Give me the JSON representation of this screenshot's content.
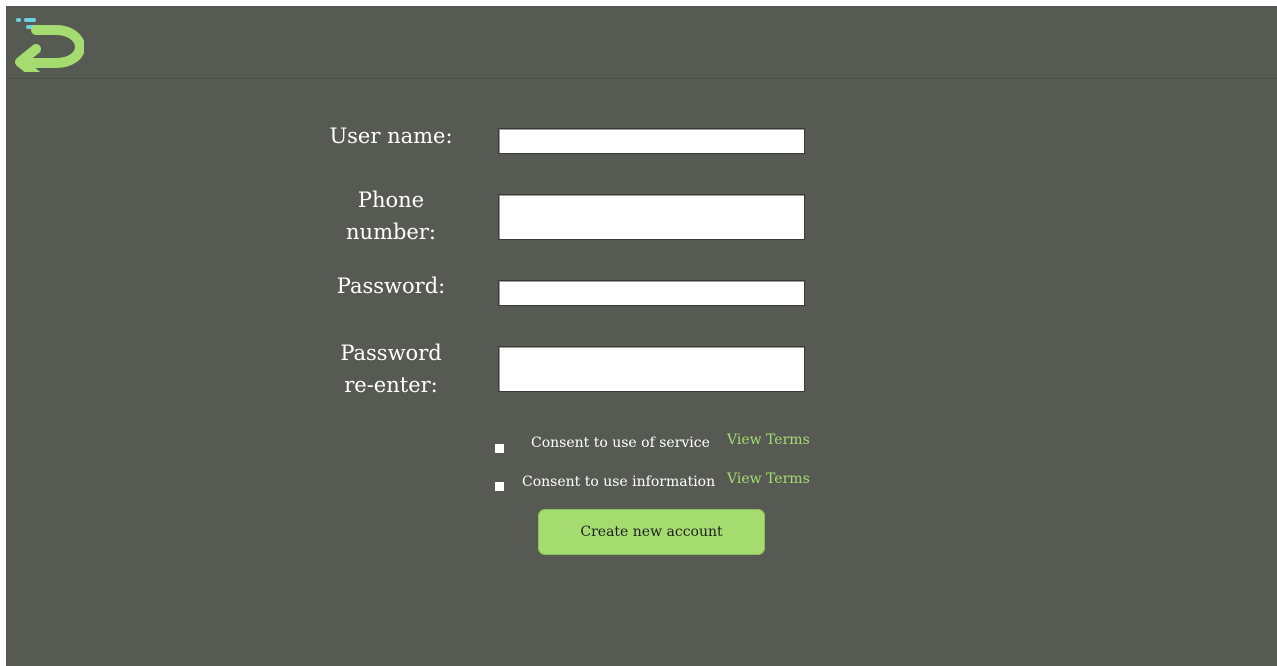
{
  "header": {
    "back_icon": "return-arrow-icon",
    "accent_color": "#a5dc70",
    "dash_color": "#6fd0e3"
  },
  "form": {
    "username_label": "User name:",
    "phone_label": "Phone\nnumber:",
    "password_label": "Password:",
    "password_reenter_label": "Password\nre-enter:",
    "username_value": "",
    "phone_value": "",
    "password_value": "",
    "password_reenter_value": ""
  },
  "consents": {
    "service_label": "Consent to use of service",
    "information_label": "Consent to use information",
    "view_terms_label": "View Terms",
    "service_checked": false,
    "information_checked": false
  },
  "actions": {
    "create_account_label": "Create new account"
  },
  "colors": {
    "background": "#575a52",
    "accent": "#a5dc70",
    "text": "#ffffff"
  }
}
